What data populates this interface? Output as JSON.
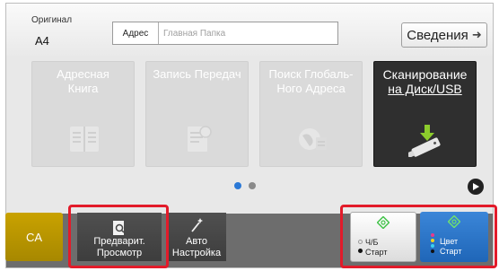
{
  "original": {
    "label": "Оригинал",
    "size": "A4"
  },
  "address": {
    "label": "Адрес",
    "value": "Главная Папка"
  },
  "details_button": {
    "label": "Сведения"
  },
  "tiles": [
    {
      "line1": "Адресная",
      "line2": "Книга"
    },
    {
      "line1": "Запись Передач",
      "line2": ""
    },
    {
      "line1": "Поиск Глобаль-",
      "line2": "Ного Адреса"
    },
    {
      "line1": "Сканирование",
      "line2": "на Диск/USB"
    }
  ],
  "pager": {
    "current": 1,
    "total": 2
  },
  "bottom": {
    "ca_label": "CA",
    "preview": {
      "line1": "Предварит.",
      "line2": "Просмотр"
    },
    "auto": {
      "line1": "Авто",
      "line2": "Настройка"
    },
    "bw_start": {
      "line1": "Ч/Б",
      "line2": "Старт"
    },
    "color_start": {
      "line1": "Цвет",
      "line2": "Старт"
    }
  },
  "colors": {
    "highlight": "#e21b2a",
    "active_dot": "#2a78d6",
    "inactive_dot": "#8a8a8a",
    "ca": "#b89400",
    "start_icon": "#43c34a"
  }
}
